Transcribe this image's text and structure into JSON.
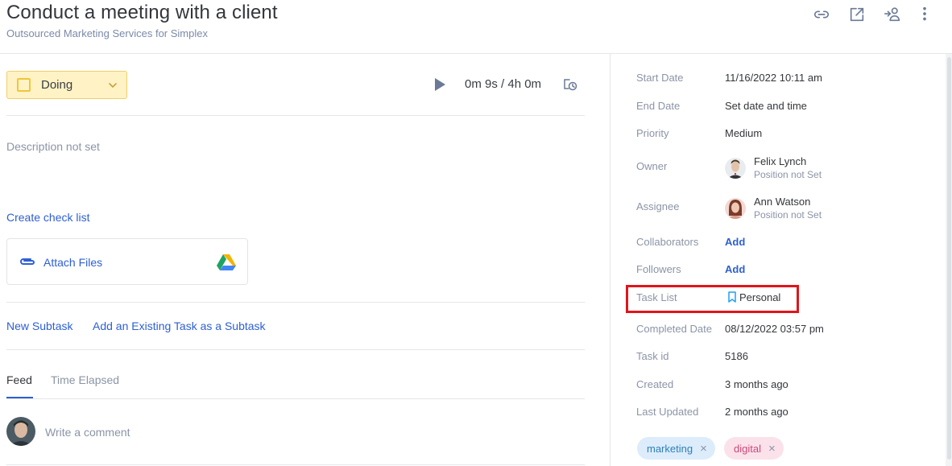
{
  "header": {
    "title": "Conduct a meeting with a client",
    "subtitle": "Outsourced Marketing Services for Simplex"
  },
  "status": {
    "label": "Doing"
  },
  "timer": {
    "text": "0m 9s / 4h 0m"
  },
  "description": {
    "placeholder": "Description not set"
  },
  "checklist": {
    "label": "Create check list"
  },
  "attach": {
    "label": "Attach Files"
  },
  "subtasks": {
    "new_label": "New Subtask",
    "existing_label": "Add an Existing Task as a Subtask"
  },
  "tabs": [
    {
      "label": "Feed"
    },
    {
      "label": "Time Elapsed"
    }
  ],
  "comment": {
    "placeholder": "Write a comment"
  },
  "details": {
    "start_date": {
      "label": "Start Date",
      "value": "11/16/2022 10:11 am"
    },
    "end_date": {
      "label": "End Date",
      "value": "Set date and time"
    },
    "priority": {
      "label": "Priority",
      "value": "Medium"
    },
    "owner": {
      "label": "Owner",
      "name": "Felix Lynch",
      "position": "Position not Set"
    },
    "assignee": {
      "label": "Assignee",
      "name": "Ann Watson",
      "position": "Position not Set"
    },
    "collaborators": {
      "label": "Collaborators",
      "value": "Add"
    },
    "followers": {
      "label": "Followers",
      "value": "Add"
    },
    "task_list": {
      "label": "Task List",
      "value": "Personal"
    },
    "completed_date": {
      "label": "Completed Date",
      "value": "08/12/2022 03:57 pm"
    },
    "task_id": {
      "label": "Task id",
      "value": "5186"
    },
    "created": {
      "label": "Created",
      "value": "3 months ago"
    },
    "last_updated": {
      "label": "Last Updated",
      "value": "2 months ago"
    }
  },
  "tags": [
    {
      "label": "marketing",
      "color": "#2e7fb8"
    },
    {
      "label": "digital",
      "color": "#c9497a"
    }
  ],
  "icons": {
    "header": [
      "link-icon",
      "open-external-icon",
      "assign-user-icon",
      "more-vertical-icon"
    ],
    "status": "chevron-down-icon",
    "timer": [
      "play-icon",
      "time-log-icon"
    ],
    "attach": [
      "paperclip-icon",
      "google-drive-icon"
    ],
    "task_list": "bookmark-icon"
  },
  "colors": {
    "accent": "#2e5fd3",
    "status_bg": "#fff3c6",
    "highlight": "#e0151a"
  }
}
